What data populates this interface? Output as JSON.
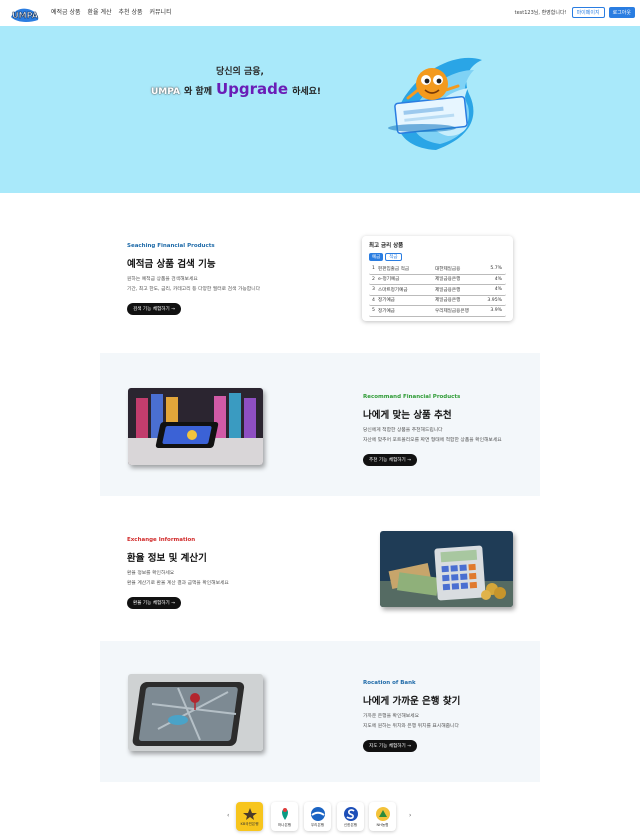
{
  "nav": {
    "logo_text": "UMPA",
    "links": [
      "예적금 상품",
      "환율 계산",
      "추천 상품",
      "커뮤니티"
    ],
    "welcome": "test123님, 환영합니다!",
    "btn_mypage": "마이페이지",
    "btn_logout": "로그아웃"
  },
  "hero": {
    "line1": "당신의 금융,",
    "brand": "UMPA",
    "with": "와 함께",
    "upgrade": "Upgrade",
    "tail": "하세요!"
  },
  "search": {
    "eyebrow": "Seaching Financial Products",
    "title": "예적금 상품 검색 기능",
    "desc1": "원하는 예적금 상품을 검색해보세요",
    "desc2": "기간, 최고 한도, 금리, 카테고리 등 다양한 필터로 검색 가능합니다",
    "button": "검색 기능 체험하기 →"
  },
  "rates_card": {
    "title": "최고 금리 상품",
    "tabs": [
      "예금",
      "적금"
    ],
    "rows": [
      {
        "n": "1",
        "product": "펀펀입출금 적금",
        "bank": "대한제일금융",
        "rate": "5.7%"
      },
      {
        "n": "2",
        "product": "e-정기예금",
        "bank": "제일금융은행",
        "rate": "4%"
      },
      {
        "n": "3",
        "product": "스마트정기예금",
        "bank": "제일금융은행",
        "rate": "4%"
      },
      {
        "n": "4",
        "product": "정기예금",
        "bank": "제일금융은행",
        "rate": "3.95%"
      },
      {
        "n": "5",
        "product": "정기예금",
        "bank": "우리제일금융은행",
        "rate": "3.9%"
      }
    ]
  },
  "recommend": {
    "eyebrow": "Recommand Financial Products",
    "title": "나에게 맞는 상품 추천",
    "desc1": "당신에게 적합한 상품을 추천해드립니다",
    "desc2": "자산에 맞추어 포트폴리오를 짜면 형태에 적합한 상품을 확인해보세요",
    "button": "추천 기능 체험하기 →"
  },
  "exchange": {
    "eyebrow": "Exchange Information",
    "title": "환율 정보 및 계산기",
    "desc1": "환율 정보를 확인하세요",
    "desc2": "환율 계산기로 환율 계산 결과 금액을 확인해보세요",
    "button": "환율 기능 체험하기 →"
  },
  "location": {
    "eyebrow": "Rocation of Bank",
    "title": "나에게 가까운 은행 찾기",
    "desc1": "가까운 은행을 확인해보세요",
    "desc2": "지도에 원하는 위치와 은행 위치를 표시해줍니다",
    "button": "지도 기능 체험하기 →"
  },
  "banks": {
    "prev": "‹",
    "next": "›",
    "items": [
      {
        "label": "KB국민은행"
      },
      {
        "label": "하나은행"
      },
      {
        "label": "우리은행"
      },
      {
        "label": "신한은행"
      },
      {
        "label": "NH농협"
      }
    ]
  },
  "colors": {
    "hero_bg": "#a9e9fa",
    "search_eyebrow": "#1e6aa8",
    "recommend_eyebrow": "#2e9b35",
    "exchange_eyebrow": "#d12a2a",
    "location_eyebrow": "#1e6aa8",
    "upgrade": "#6a1db6",
    "accent": "#2a7de1"
  }
}
